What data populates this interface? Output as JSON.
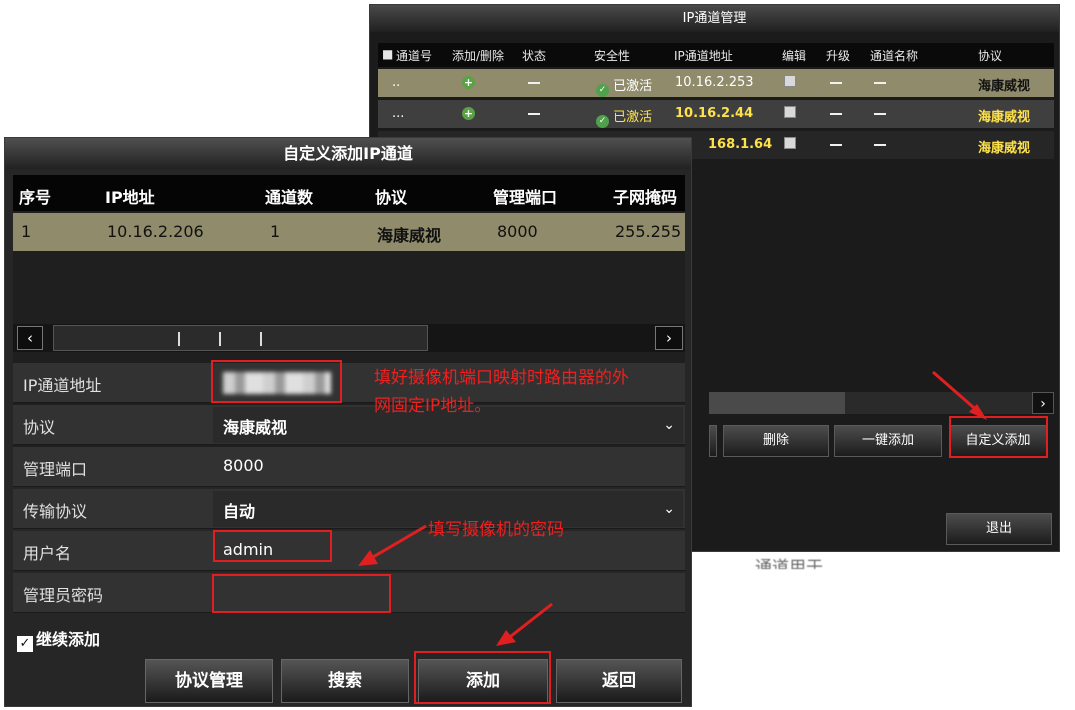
{
  "bg_window": {
    "title": "IP通道管理",
    "columns": [
      "通道号",
      "添加/删除",
      "状态",
      "安全性",
      "IP通道地址",
      "编辑",
      "升级",
      "通道名称",
      "协议"
    ],
    "rows": [
      {
        "channel": "..",
        "status": "",
        "security": "已激活",
        "ip": "10.16.2.253",
        "protocol": "海康威视"
      },
      {
        "channel": "...",
        "status": "",
        "security": "已激活",
        "ip": "10.16.2.44",
        "protocol": "海康威视"
      },
      {
        "channel": "",
        "status": "",
        "security": "",
        "ip": "168.1.64",
        "protocol": "海康威视"
      }
    ],
    "buttons": {
      "delete": "删除",
      "one_key_add": "一键添加",
      "custom_add": "自定义添加",
      "exit": "退出"
    },
    "status_text": "通道用于"
  },
  "dialog": {
    "title": "自定义添加IP通道",
    "columns": [
      "序号",
      "IP地址",
      "通道数",
      "协议",
      "管理端口",
      "子网掩码"
    ],
    "row": {
      "index": "1",
      "ip": "10.16.2.206",
      "channels": "1",
      "protocol": "海康威视",
      "port": "8000",
      "mask": "255.255"
    },
    "form": {
      "ip_label": "IP通道地址",
      "protocol_label": "协议",
      "protocol_value": "海康威视",
      "port_label": "管理端口",
      "port_value": "8000",
      "transport_label": "传输协议",
      "transport_value": "自动",
      "user_label": "用户名",
      "user_value": "admin",
      "pwd_label": "管理员密码",
      "pwd_value": ""
    },
    "continue_add": "继续添加",
    "buttons": {
      "protocol_mgmt": "协议管理",
      "search": "搜索",
      "add": "添加",
      "back": "返回"
    }
  },
  "annotations": {
    "ip_note_line1": "填好摄像机端口映射时路由器的外",
    "ip_note_line2": "网固定IP地址。",
    "pwd_note": "填写摄像机的密码"
  },
  "colors": {
    "annotation_red": "#e02020",
    "selected_row": "#8f8b6b",
    "protocol_yellow": "#ffe24a"
  }
}
